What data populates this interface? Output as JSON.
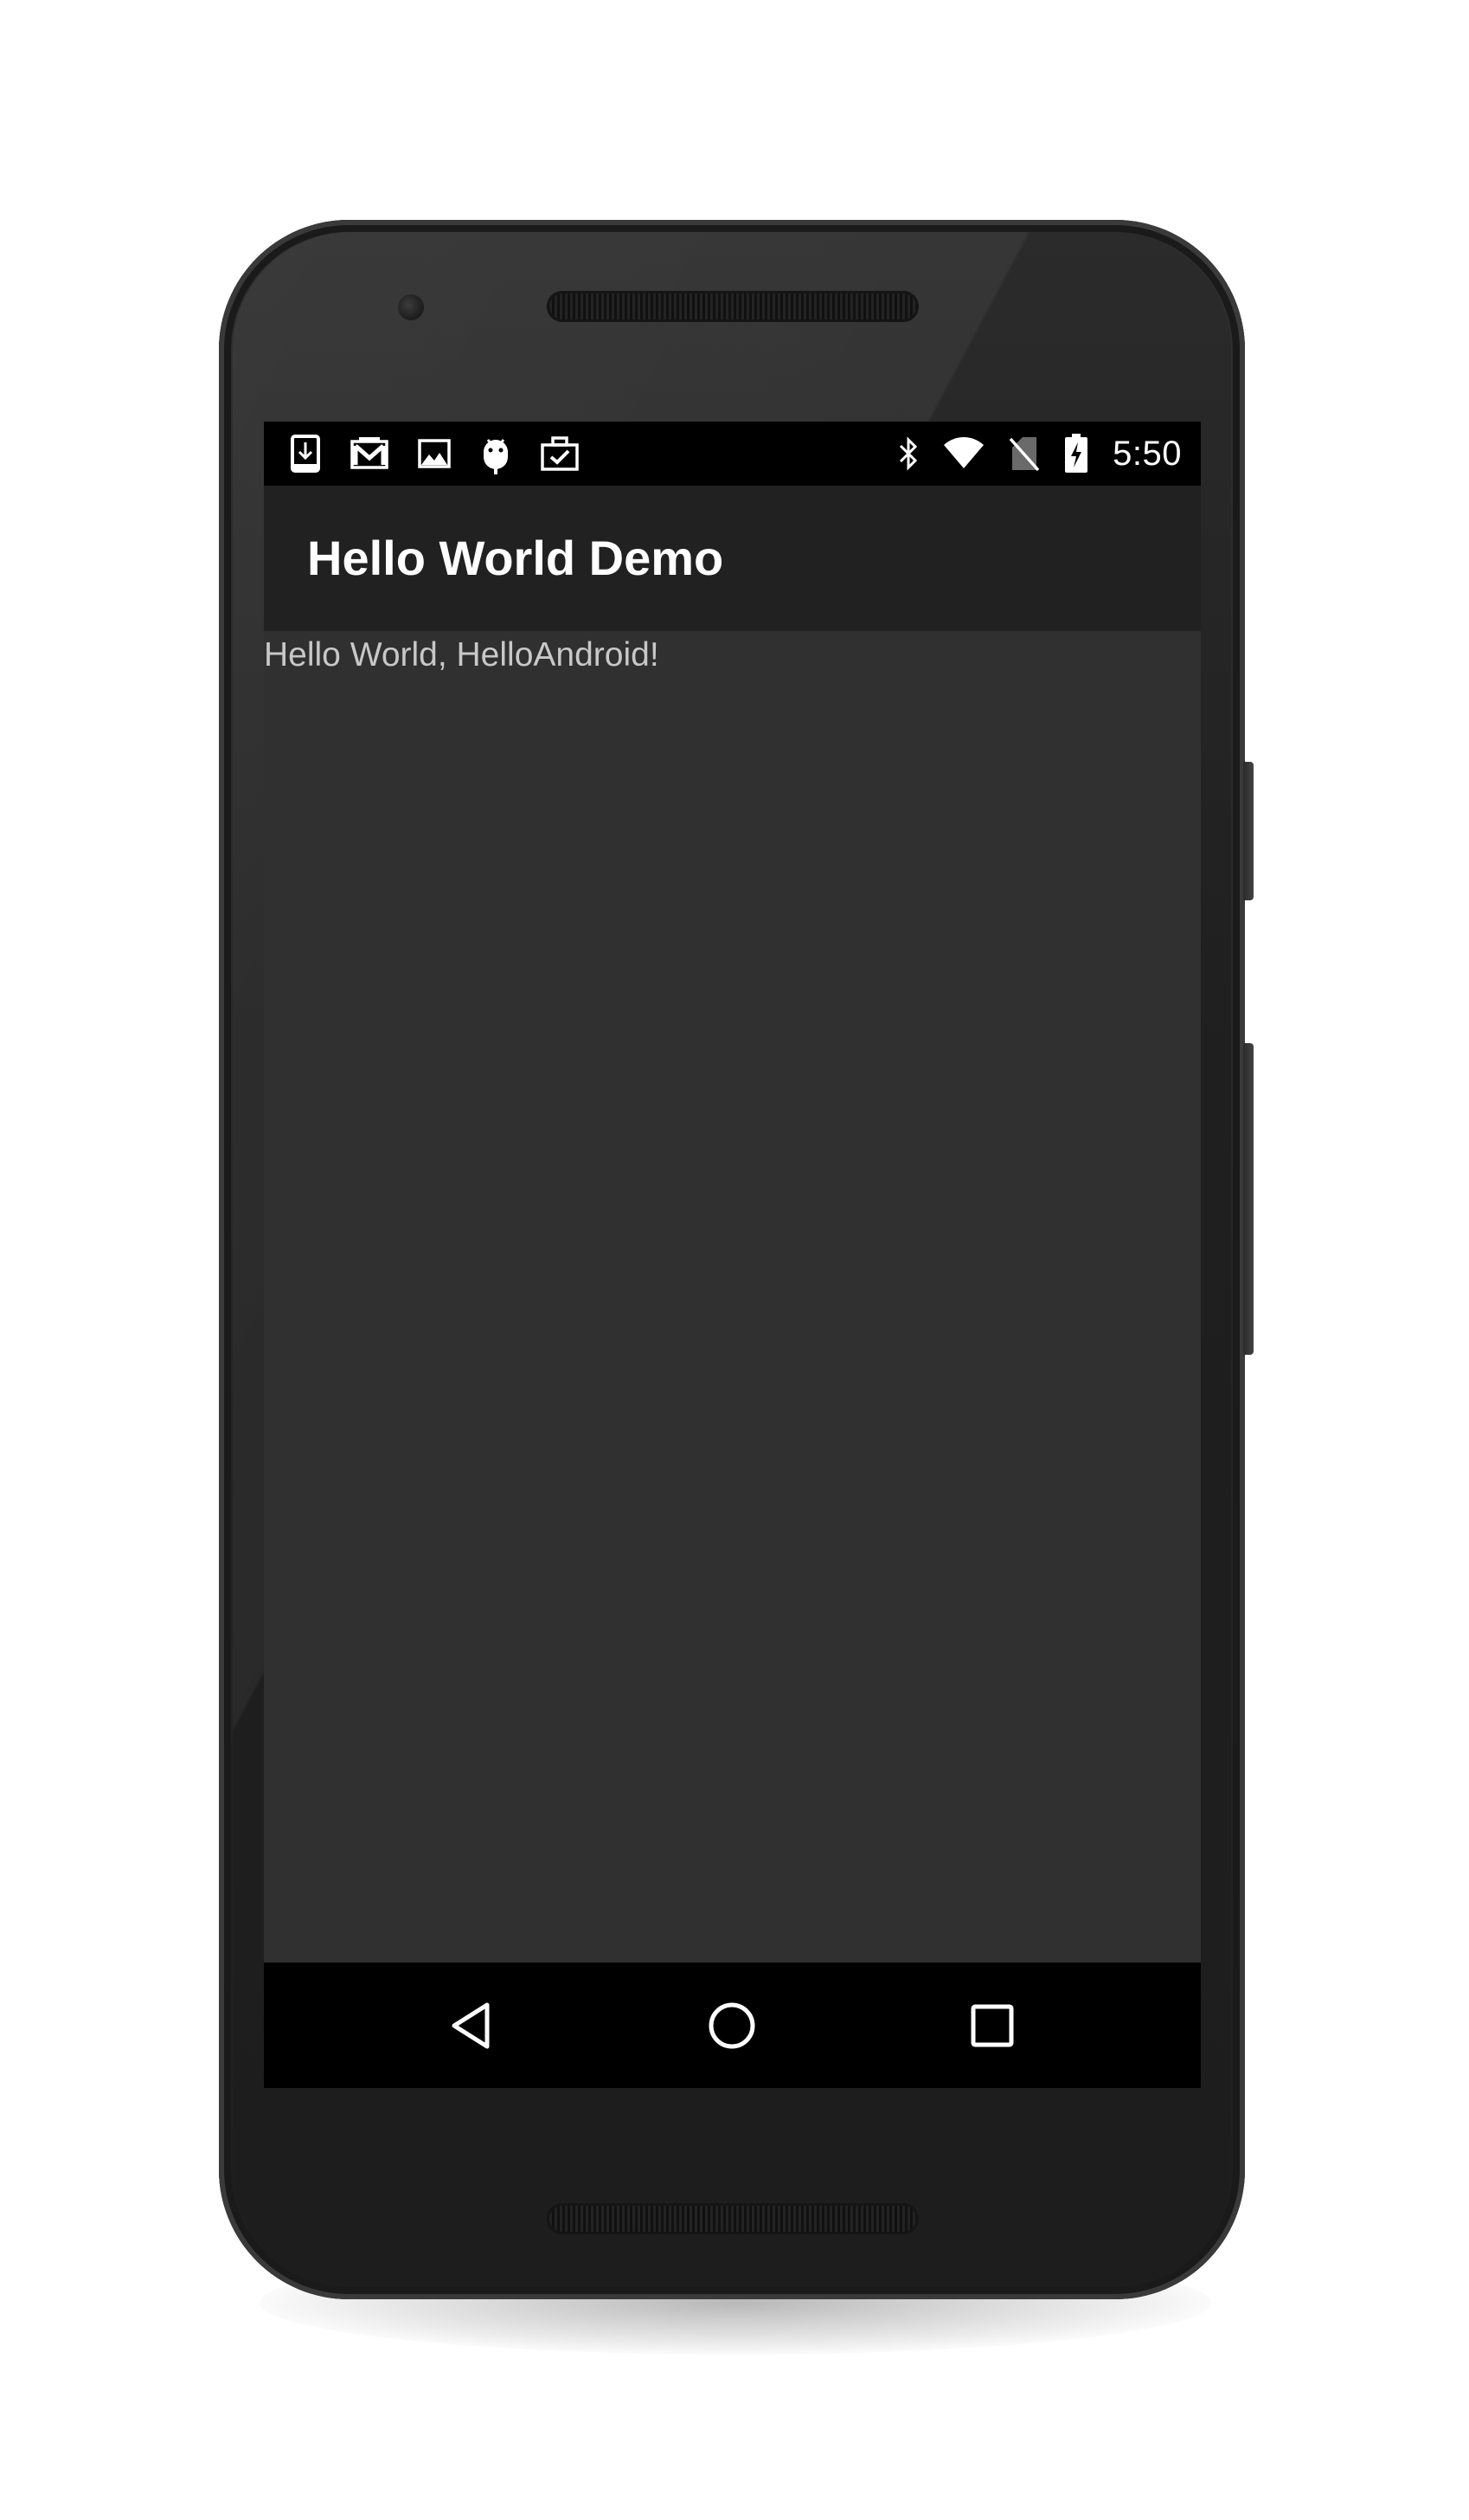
{
  "status_bar": {
    "time": "5:50",
    "left_icons": [
      "download-icon",
      "gmail-icon",
      "image-icon",
      "android-icon",
      "work-briefcase-icon"
    ],
    "right_icons": [
      "bluetooth-icon",
      "wifi-icon",
      "no-sim-icon",
      "battery-charging-icon"
    ]
  },
  "app_bar": {
    "title": "Hello World Demo"
  },
  "content": {
    "text": "Hello World, HelloAndroid!"
  },
  "nav_bar": {
    "buttons": [
      "back-icon",
      "home-icon",
      "recents-icon"
    ]
  },
  "colors": {
    "status_bar": "#000000",
    "app_bar": "#212121",
    "background": "#303030",
    "title_text": "#ffffff",
    "body_text": "#c8c8c8",
    "nav_bar": "#000000"
  }
}
